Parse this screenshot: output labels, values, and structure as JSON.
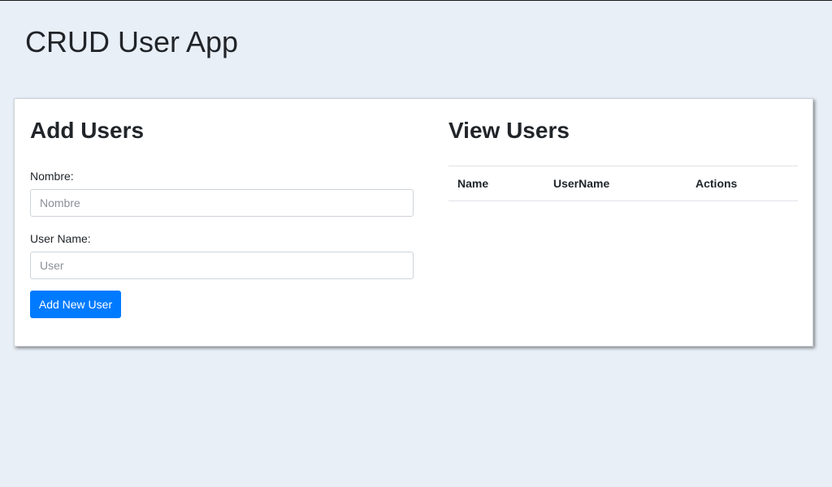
{
  "app": {
    "title": "CRUD User App"
  },
  "add_users": {
    "heading": "Add Users",
    "name_label": "Nombre:",
    "name_placeholder": "Nombre",
    "name_value": "",
    "username_label": "User Name:",
    "username_placeholder": "User",
    "username_value": "",
    "submit_label": "Add New User"
  },
  "view_users": {
    "heading": "View Users",
    "columns": [
      "Name",
      "UserName",
      "Actions"
    ],
    "rows": []
  },
  "colors": {
    "background": "#e9eff7",
    "primary": "#007bff",
    "card": "#ffffff"
  }
}
